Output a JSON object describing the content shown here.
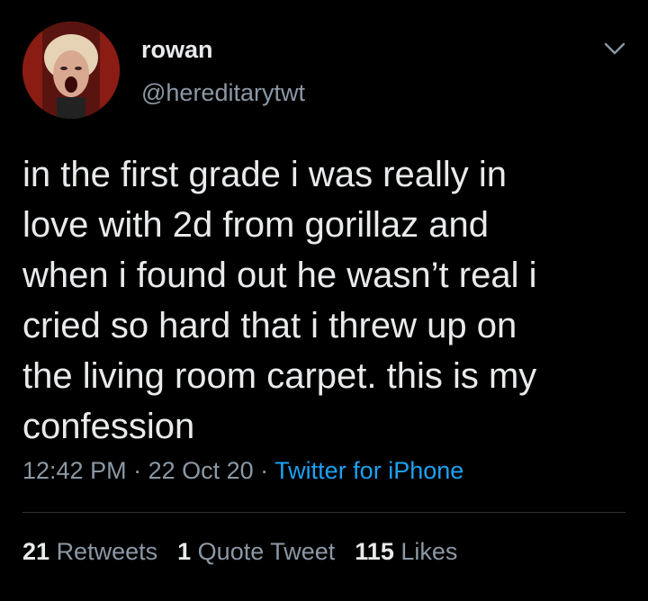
{
  "tweet": {
    "display_name": "rowan",
    "handle": "@hereditarytwt",
    "text": "in the first grade i was really in\nlove with 2d from gorillaz and\nwhen i found out he wasn’t real i\ncried so hard that i threw up on\nthe living room carpet. this is my\nconfession",
    "time": "12:42 PM",
    "separator": " · ",
    "date": "22 Oct 20",
    "source": "Twitter for iPhone"
  },
  "stats": {
    "retweets_count": "21",
    "retweets_label": "Retweets",
    "quotes_count": "1",
    "quotes_label": "Quote Tweet",
    "likes_count": "115",
    "likes_label": "Likes"
  },
  "icons": {
    "menu": "chevron-down-icon",
    "avatar": "profile-avatar"
  },
  "colors": {
    "background": "#000000",
    "primary_text": "#e8eaec",
    "secondary_text": "#8b98a5",
    "link": "#1da1f2",
    "divider": "#2f3336"
  }
}
